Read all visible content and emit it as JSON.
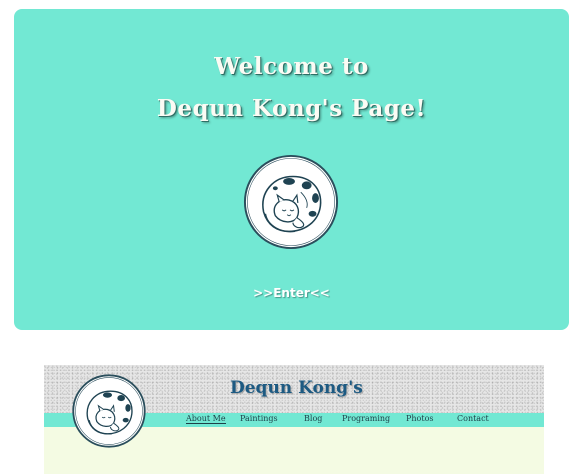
{
  "hero": {
    "title_line1": "Welcome to",
    "title_line2": "Dequn Kong's Page!",
    "enter_label": ">>Enter<<",
    "background_color": "#72e8d3",
    "logo_icon": "sleeping-cat-logo-icon"
  },
  "preview": {
    "site_title": "Dequn Kong's",
    "nav": [
      {
        "label": "About Me"
      },
      {
        "label": "Paintings"
      },
      {
        "label": "Blog"
      },
      {
        "label": "Programing"
      },
      {
        "label": "Photos"
      },
      {
        "label": "Contact"
      }
    ],
    "logo_icon": "sleeping-cat-logo-icon",
    "nav_color": "#72e8d3",
    "body_color": "#f4fbe3"
  }
}
